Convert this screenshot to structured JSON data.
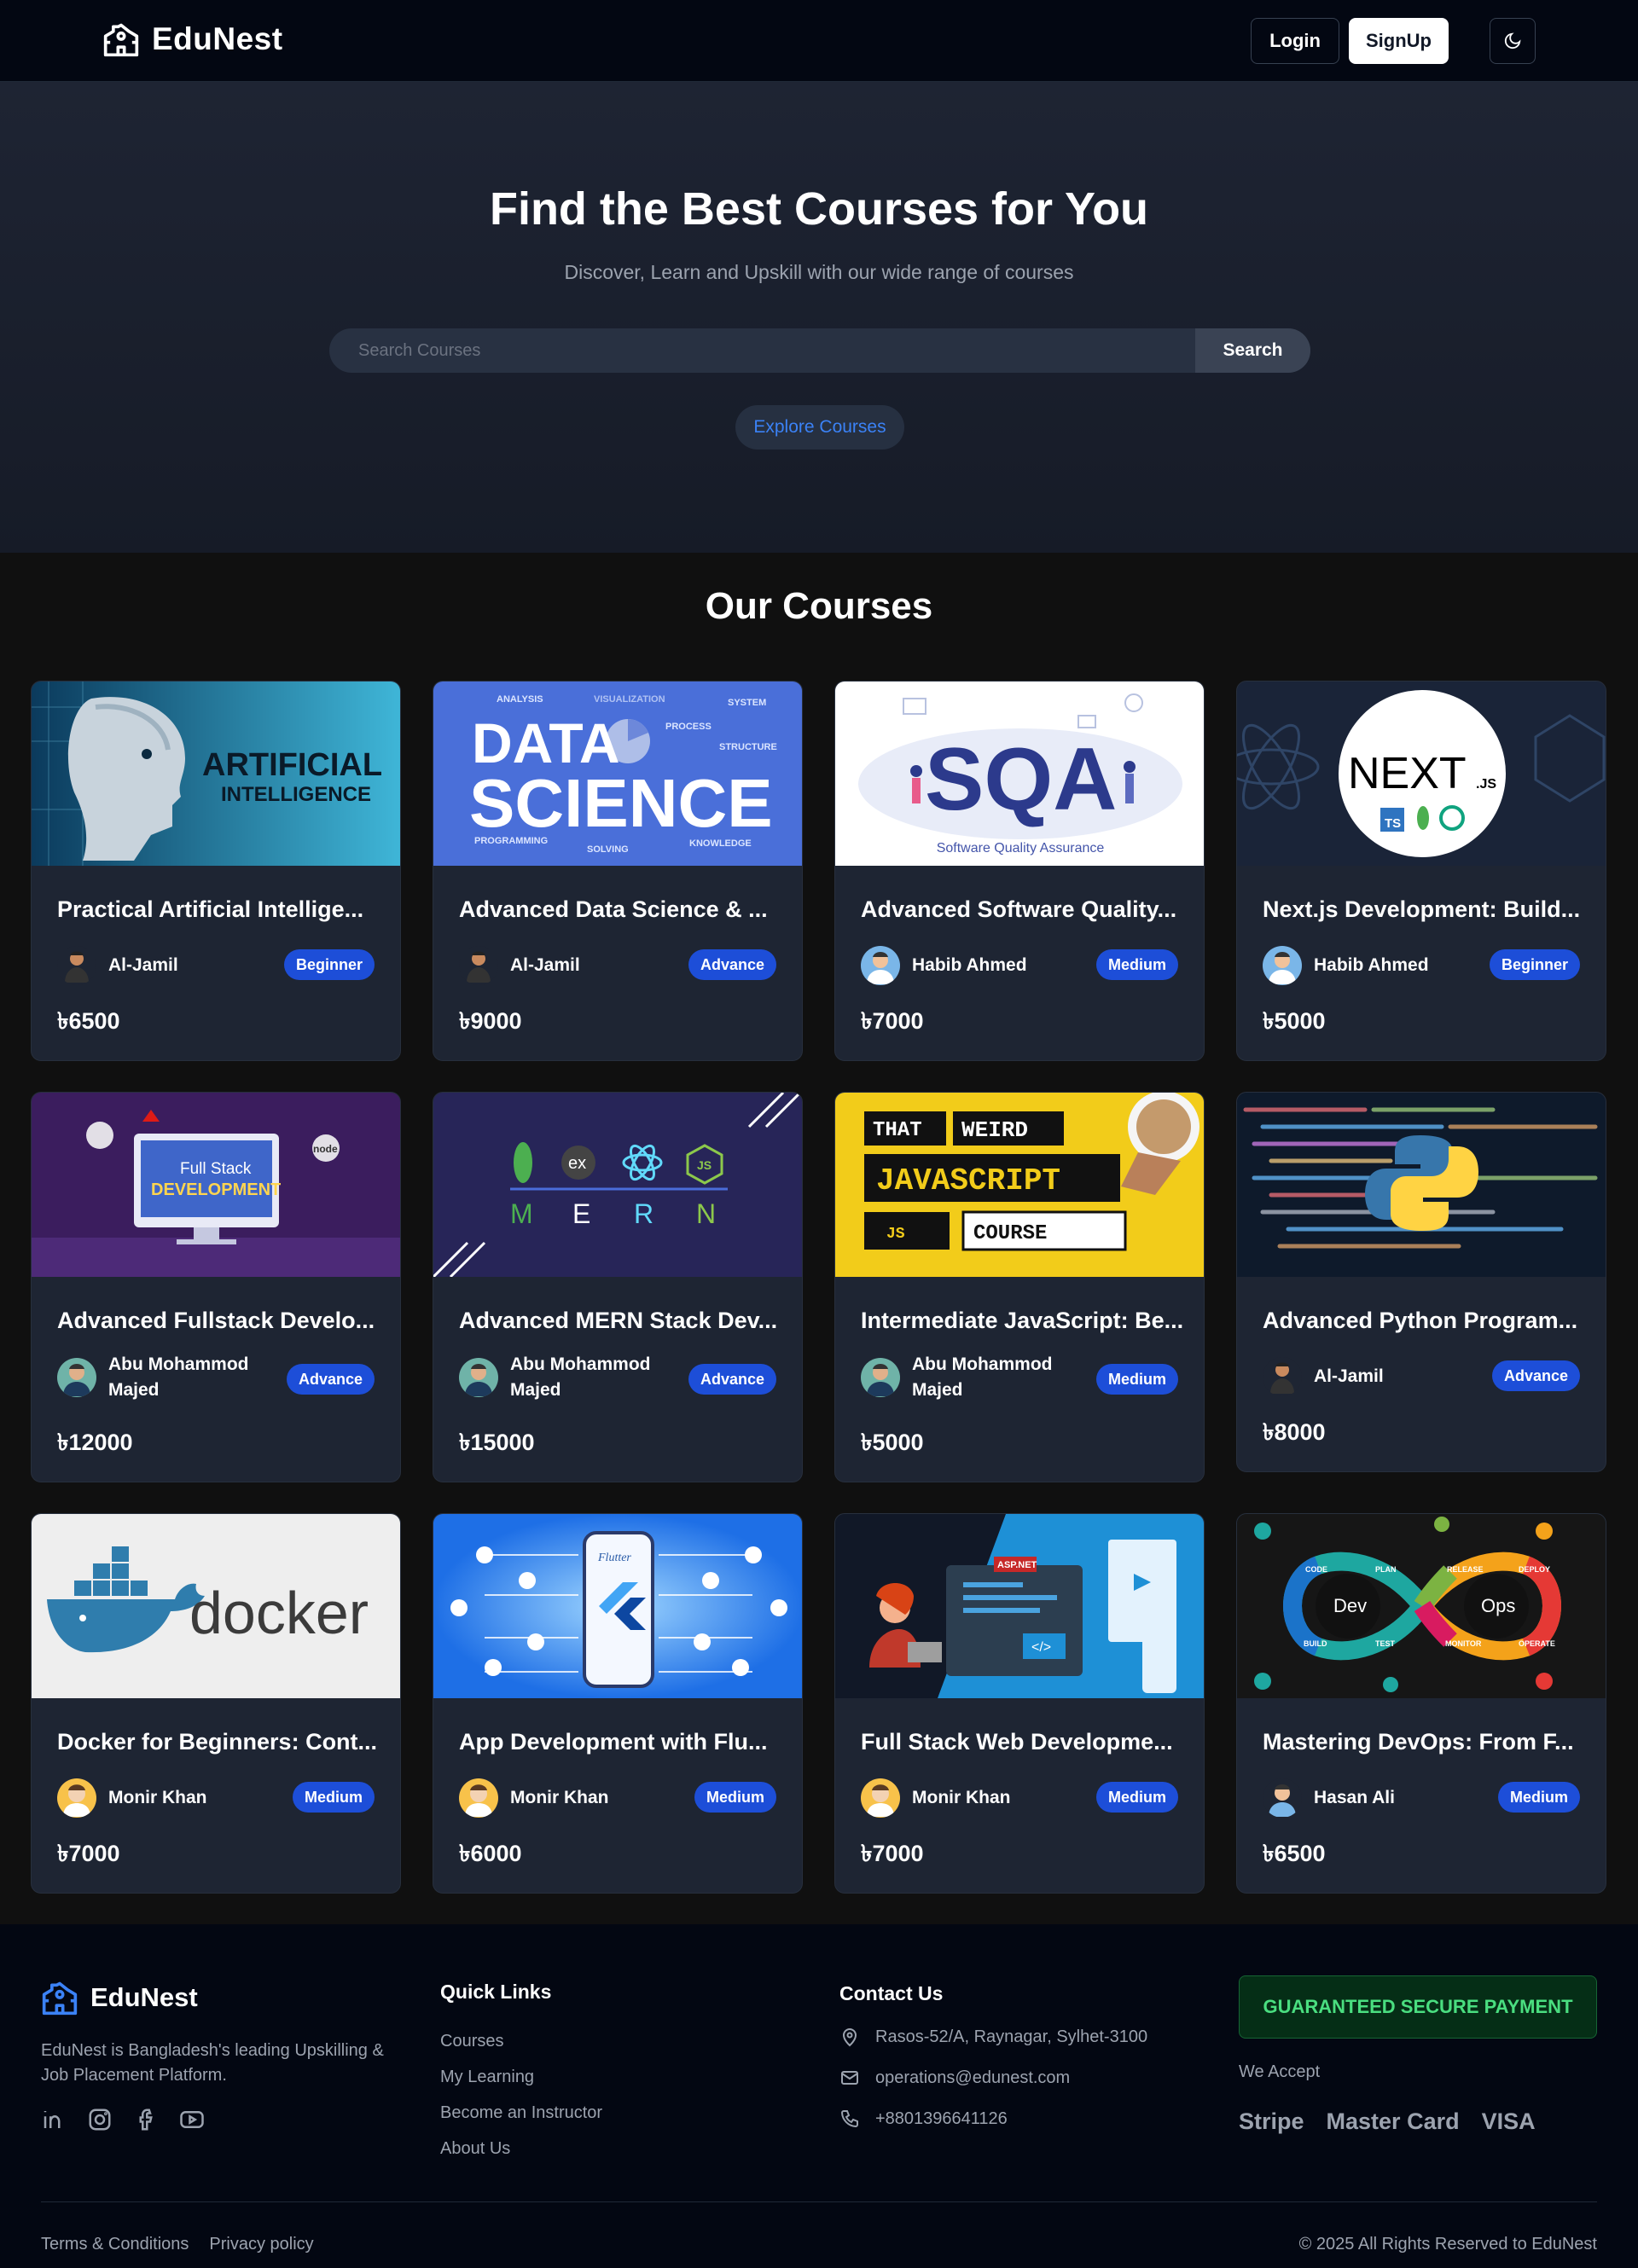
{
  "brand": {
    "name": "EduNest"
  },
  "nav": {
    "login": "Login",
    "signup": "SignUp"
  },
  "hero": {
    "title": "Find the Best Courses for You",
    "subtitle": "Discover, Learn and Upskill with our wide range of courses",
    "search_placeholder": "Search Courses",
    "search_button": "Search",
    "explore_button": "Explore Courses"
  },
  "courses_title": "Our Courses",
  "courses": [
    {
      "title": "Practical Artificial Intellige...",
      "instructor": "Al-Jamil",
      "level": "Beginner",
      "price": "৳6500",
      "thumb": "artificial-intelligence"
    },
    {
      "title": "Advanced Data Science & ...",
      "instructor": "Al-Jamil",
      "level": "Advance",
      "price": "৳9000",
      "thumb": "data-science"
    },
    {
      "title": "Advanced Software Quality...",
      "instructor": "Habib Ahmed",
      "level": "Medium",
      "price": "৳7000",
      "thumb": "sqa"
    },
    {
      "title": "Next.js Development: Build...",
      "instructor": "Habib Ahmed",
      "level": "Beginner",
      "price": "৳5000",
      "thumb": "nextjs"
    },
    {
      "title": "Advanced Fullstack Develo...",
      "instructor": "Abu Mohammod Majed",
      "level": "Advance",
      "price": "৳12000",
      "thumb": "full-stack"
    },
    {
      "title": "Advanced MERN Stack Dev...",
      "instructor": "Abu Mohammod Majed",
      "level": "Advance",
      "price": "৳15000",
      "thumb": "mern"
    },
    {
      "title": "Intermediate JavaScript: Be...",
      "instructor": "Abu Mohammod Majed",
      "level": "Medium",
      "price": "৳5000",
      "thumb": "javascript"
    },
    {
      "title": "Advanced Python Program...",
      "instructor": "Al-Jamil",
      "level": "Advance",
      "price": "৳8000",
      "thumb": "python"
    },
    {
      "title": "Docker for Beginners: Cont...",
      "instructor": "Monir Khan",
      "level": "Medium",
      "price": "৳7000",
      "thumb": "docker"
    },
    {
      "title": "App Development with Flu...",
      "instructor": "Monir Khan",
      "level": "Medium",
      "price": "৳6000",
      "thumb": "flutter"
    },
    {
      "title": "Full Stack Web Developme...",
      "instructor": "Monir Khan",
      "level": "Medium",
      "price": "৳7000",
      "thumb": "aspnet"
    },
    {
      "title": "Mastering DevOps: From F...",
      "instructor": "Hasan Ali",
      "level": "Medium",
      "price": "৳6500",
      "thumb": "devops"
    }
  ],
  "thumb_text": {
    "ai": [
      "ARTIFICIAL",
      "INTELLIGENCE"
    ],
    "ds": [
      "DATA",
      "SCIENCE",
      "ANALYSIS",
      "VISUALIZATION",
      "SYSTEM",
      "PROCESS",
      "STRUCTURE",
      "PROGRAMMING",
      "SOLVING",
      "KNOWLEDGE"
    ],
    "sqa": [
      "SQA",
      "Software Quality Assurance"
    ],
    "next": [
      "NEXT",
      ".JS",
      "TS"
    ],
    "fs": [
      "Full Stack",
      "DEVELOPMENT",
      "node"
    ],
    "mern": [
      "M",
      "E",
      "R",
      "N",
      "ex",
      "JS"
    ],
    "js": [
      "THAT",
      "WEIRD",
      "JAVASCRIPT",
      "JS",
      "COURSE"
    ],
    "docker": [
      "docker"
    ],
    "flutter": [
      "Flutter"
    ],
    "asp": [
      "ASP.NET"
    ],
    "devops": [
      "Dev",
      "Ops",
      "CODE",
      "PLAN",
      "RELEASE",
      "DEPLOY",
      "BUILD",
      "TEST",
      "MONITOR",
      "OPERATE"
    ]
  },
  "footer": {
    "brand": "EduNest",
    "description": "EduNest is Bangladesh's leading Upskilling & Job Placement Platform.",
    "quick_links_title": "Quick Links",
    "quick_links": [
      "Courses",
      "My Learning",
      "Become an Instructor",
      "About Us"
    ],
    "contact_title": "Contact Us",
    "address": "Rasos-52/A, Raynagar, Sylhet-3100",
    "email": "operations@edunest.com",
    "phone": "+8801396641126",
    "secure_payment": "GUARANTEED SECURE PAYMENT",
    "we_accept": "We Accept",
    "payments": [
      "Stripe",
      "Master Card",
      "VISA"
    ],
    "terms": "Terms & Conditions",
    "privacy": "Privacy policy",
    "copyright": "© 2025 All Rights Reserved to EduNest"
  }
}
